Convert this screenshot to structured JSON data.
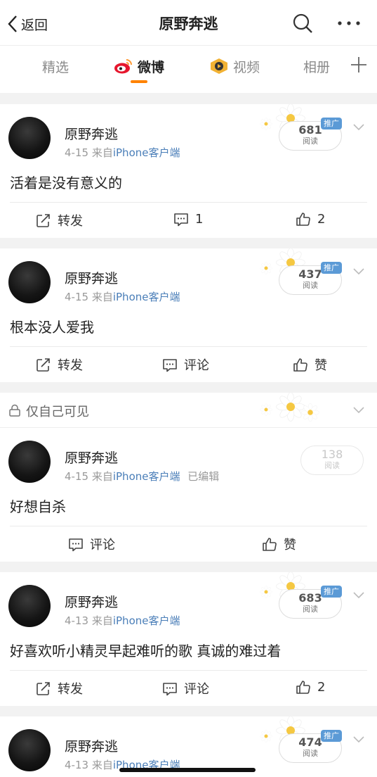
{
  "header": {
    "back_label": "返回",
    "title": "原野奔逃"
  },
  "tabs": [
    {
      "label": "精选"
    },
    {
      "label": "微博"
    },
    {
      "label": "视频"
    },
    {
      "label": "相册"
    }
  ],
  "active_tab": "微博",
  "colors": {
    "accent": "#ff8200",
    "link": "#4a7eb8",
    "promo": "#5b9ad6"
  },
  "private_bar": {
    "text": "仅自己可见"
  },
  "posts": [
    {
      "author": "原野奔逃",
      "date": "4-15",
      "source_prefix": "来自",
      "source": "iPhone客户端",
      "text": "活着是没有意义的",
      "reads": "681",
      "reads_label": "阅读",
      "promo": "推广",
      "repost": "转发",
      "comment": "1",
      "like": "2"
    },
    {
      "author": "原野奔逃",
      "date": "4-15",
      "source_prefix": "来自",
      "source": "iPhone客户端",
      "text": "根本没人爱我",
      "reads": "437",
      "reads_label": "阅读",
      "promo": "推广",
      "repost": "转发",
      "comment": "评论",
      "like": "赞"
    },
    {
      "author": "原野奔逃",
      "date": "4-15",
      "source_prefix": "来自",
      "source": "iPhone客户端",
      "edited": "已编辑",
      "text": "好想自杀",
      "reads": "138",
      "reads_label": "阅读",
      "comment": "评论",
      "like": "赞"
    },
    {
      "author": "原野奔逃",
      "date": "4-13",
      "source_prefix": "来自",
      "source": "iPhone客户端",
      "text": "好喜欢听小精灵早起难听的歌 真诚的难过着",
      "reads": "683",
      "reads_label": "阅读",
      "promo": "推广",
      "repost": "转发",
      "comment": "评论",
      "like": "2"
    },
    {
      "author": "原野奔逃",
      "date": "4-13",
      "source_prefix": "来自",
      "source": "iPhone客户端",
      "reads": "474",
      "reads_label": "阅读",
      "promo": "推广"
    }
  ]
}
